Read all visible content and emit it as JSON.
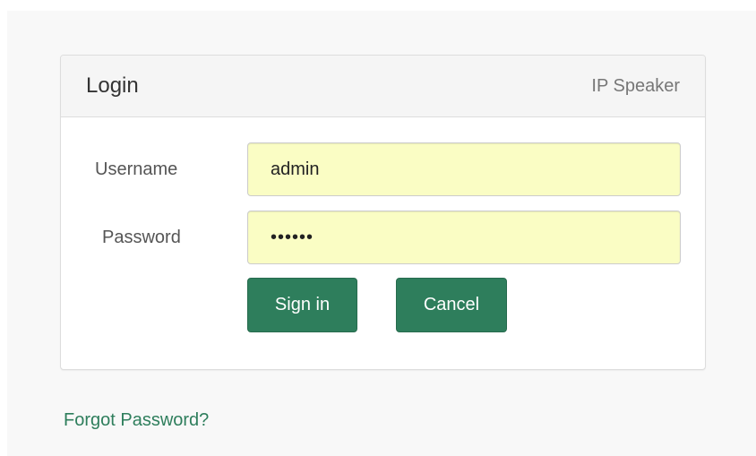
{
  "panel": {
    "title": "Login",
    "subtitle": "IP Speaker"
  },
  "form": {
    "username_label": "Username",
    "username_value": "admin",
    "password_label": "Password",
    "password_value": "••••••",
    "signin_label": "Sign in",
    "cancel_label": "Cancel"
  },
  "links": {
    "forgot_password": "Forgot Password?"
  },
  "colors": {
    "accent": "#2e7e5c",
    "input_autofill_bg": "#fafdc4"
  }
}
